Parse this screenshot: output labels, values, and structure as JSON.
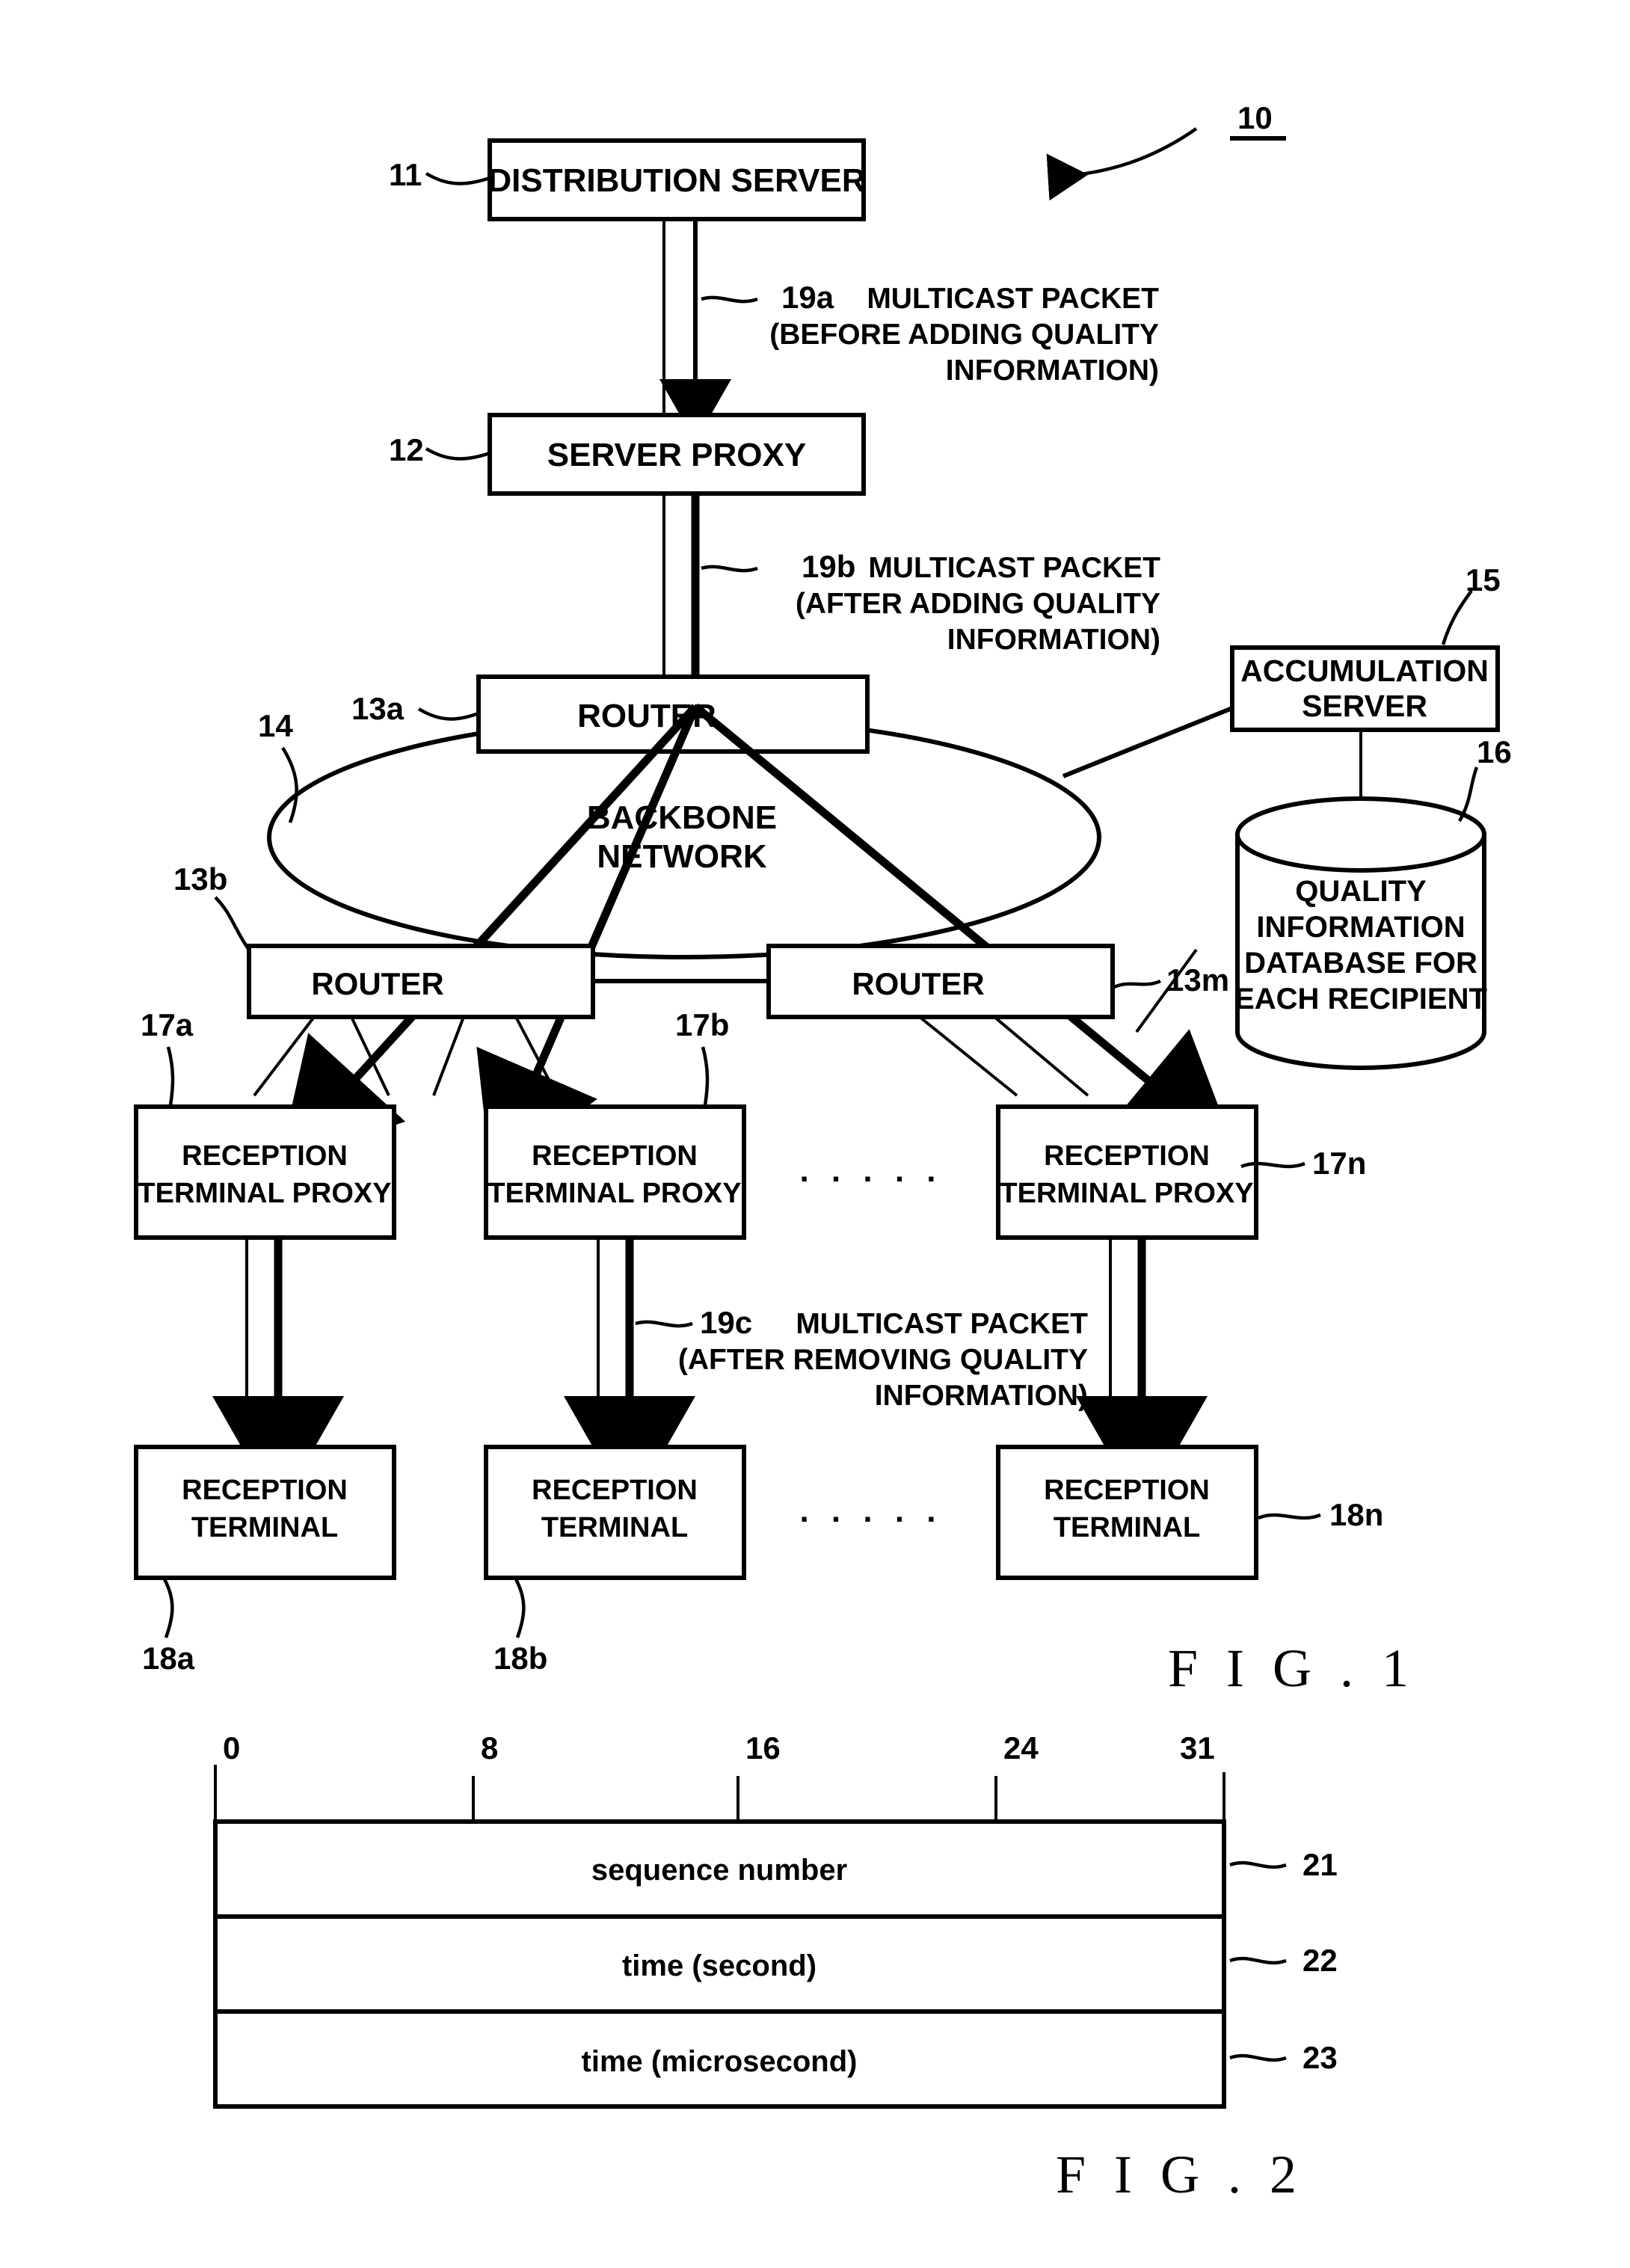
{
  "figure1": {
    "caption": "F I G . 1",
    "system_ref": "10",
    "nodes": {
      "distribution_server": {
        "label": "DISTRIBUTION SERVER",
        "ref": "11"
      },
      "server_proxy": {
        "label": "SERVER PROXY",
        "ref": "12"
      },
      "router_top": {
        "label": "ROUTER",
        "ref": "13a"
      },
      "router_left": {
        "label": "ROUTER",
        "ref": "13b"
      },
      "router_right": {
        "label": "ROUTER",
        "ref": "13m"
      },
      "backbone_network": {
        "label_line1": "BACKBONE",
        "label_line2": "NETWORK",
        "ref": "14"
      },
      "accumulation_server": {
        "label_line1": "ACCUMULATION",
        "label_line2": "SERVER",
        "ref": "15"
      },
      "quality_database": {
        "label_line1": "QUALITY",
        "label_line2": "INFORMATION",
        "label_line3": "DATABASE FOR",
        "label_line4": "EACH RECIPIENT",
        "ref": "16"
      },
      "reception_terminal_proxies": [
        {
          "label_line1": "RECEPTION",
          "label_line2": "TERMINAL PROXY",
          "ref": "17a"
        },
        {
          "label_line1": "RECEPTION",
          "label_line2": "TERMINAL PROXY",
          "ref": "17b"
        },
        {
          "label_line1": "RECEPTION",
          "label_line2": "TERMINAL PROXY",
          "ref": "17n"
        }
      ],
      "reception_terminals": [
        {
          "label_line1": "RECEPTION",
          "label_line2": "TERMINAL",
          "ref": "18a"
        },
        {
          "label_line1": "RECEPTION",
          "label_line2": "TERMINAL",
          "ref": "18b"
        },
        {
          "label_line1": "RECEPTION",
          "label_line2": "TERMINAL",
          "ref": "18n"
        }
      ]
    },
    "annotations": [
      {
        "ref": "19a",
        "line1": "MULTICAST PACKET",
        "line2": "(BEFORE ADDING QUALITY",
        "line3": "INFORMATION)"
      },
      {
        "ref": "19b",
        "line1": "MULTICAST PACKET",
        "line2": "(AFTER ADDING QUALITY",
        "line3": "INFORMATION)"
      },
      {
        "ref": "19c",
        "line1": "MULTICAST PACKET",
        "line2": "(AFTER REMOVING QUALITY",
        "line3": "INFORMATION)"
      }
    ],
    "ellipsis": ". . . . ."
  },
  "figure2": {
    "caption": "F I G . 2",
    "bit_ruler": [
      "0",
      "8",
      "16",
      "24",
      "31"
    ],
    "rows": [
      {
        "label": "sequence number",
        "ref": "21"
      },
      {
        "label": "time (second)",
        "ref": "22"
      },
      {
        "label": "time (microsecond)",
        "ref": "23"
      }
    ]
  }
}
